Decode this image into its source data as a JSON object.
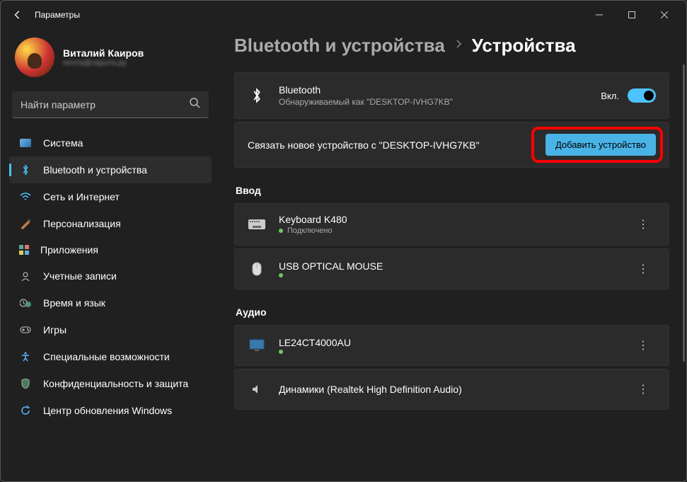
{
  "titlebar": {
    "app_title": "Параметры"
  },
  "user": {
    "name": "Виталий Каиров",
    "email": "почта@скрыта.ру"
  },
  "search": {
    "placeholder": "Найти параметр"
  },
  "nav": [
    {
      "label": "Система",
      "icon": "system"
    },
    {
      "label": "Bluetooth и устройства",
      "icon": "bluetooth",
      "active": true
    },
    {
      "label": "Сеть и Интернет",
      "icon": "wifi"
    },
    {
      "label": "Персонализация",
      "icon": "personalization"
    },
    {
      "label": "Приложения",
      "icon": "apps"
    },
    {
      "label": "Учетные записи",
      "icon": "accounts"
    },
    {
      "label": "Время и язык",
      "icon": "time-language"
    },
    {
      "label": "Игры",
      "icon": "gaming"
    },
    {
      "label": "Специальные возможности",
      "icon": "accessibility"
    },
    {
      "label": "Конфиденциальность и защита",
      "icon": "privacy"
    },
    {
      "label": "Центр обновления Windows",
      "icon": "update"
    }
  ],
  "breadcrumb": {
    "parent": "Bluetooth и устройства",
    "current": "Устройства"
  },
  "bluetooth_card": {
    "title": "Bluetooth",
    "subtitle": "Обнаруживаемый как \"DESKTOP-IVHG7KB\"",
    "toggle_label": "Вкл.",
    "toggle_on": true
  },
  "pair_card": {
    "text": "Связать новое устройство с \"DESKTOP-IVHG7KB\"",
    "button": "Добавить устройство"
  },
  "sections": {
    "input": {
      "title": "Ввод",
      "devices": [
        {
          "name": "Keyboard K480",
          "status": "Подключено",
          "icon": "keyboard"
        },
        {
          "name": "USB OPTICAL MOUSE",
          "status": "",
          "icon": "mouse"
        }
      ]
    },
    "audio": {
      "title": "Аудио",
      "devices": [
        {
          "name": "LE24CT4000AU",
          "status": "",
          "icon": "display"
        },
        {
          "name": "Динамики (Realtek High Definition Audio)",
          "status": "",
          "icon": "speaker"
        }
      ]
    }
  }
}
